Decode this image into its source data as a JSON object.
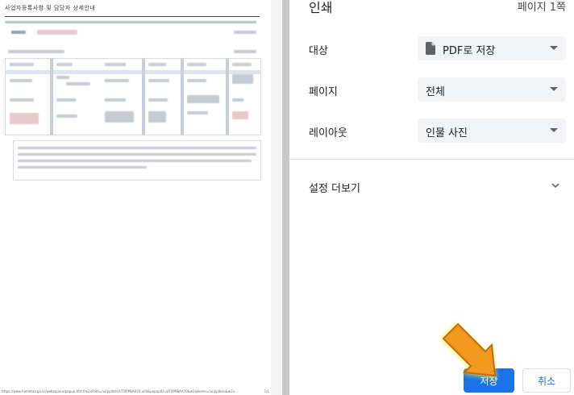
{
  "preview": {
    "doc_title": "사업자등록사항 및 담당자 상세안내",
    "footer_url": "https://www.hometax.go.kr/websquare/popup.html?w2xPath=/ui/pp/brie/UTXPPBAA70.xml&popupID=UTXPPBAA70&w2xHome=/ui/pp/brie&w2x...",
    "footer_page": "1/1"
  },
  "panel": {
    "title": "인쇄",
    "page_count": "페이지 1쪽",
    "destination": {
      "label": "대상",
      "value": "PDF로 저장",
      "icon": "document-icon"
    },
    "pages": {
      "label": "페이지",
      "value": "전체"
    },
    "layout": {
      "label": "레이아웃",
      "value": "인물 사진"
    },
    "more_settings": {
      "label": "설정 더보기",
      "icon": "chevron-down-icon"
    },
    "save_label": "저장",
    "cancel_label": "취소"
  },
  "colors": {
    "primary": "#1a73e8",
    "select_bg": "#f1f3f4",
    "pointer": "#f29a1f"
  }
}
